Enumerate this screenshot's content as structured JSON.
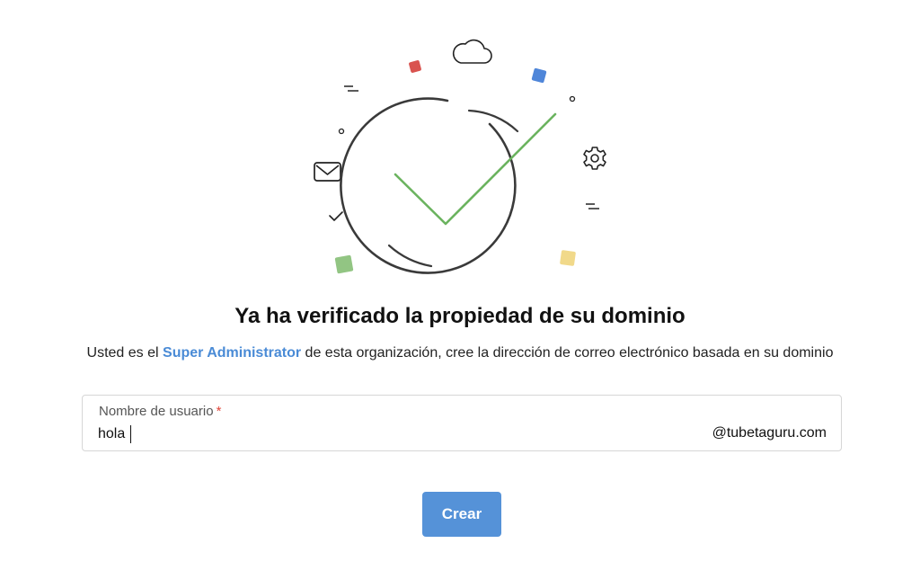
{
  "heading": "Ya ha verificado la propiedad de su dominio",
  "subtitle": {
    "before": "Usted es el ",
    "highlight": "Super Administrator",
    "after": " de esta organización, cree la dirección de correo electrónico basada en su dominio"
  },
  "username_field": {
    "label": "Nombre de usuario",
    "required_mark": "*",
    "value": "hola",
    "domain_suffix": "@tubetaguru.com"
  },
  "create_button": {
    "label": "Crear"
  },
  "colors": {
    "accent": "#5592d8",
    "highlight_text": "#4a8bd6",
    "check_green": "#6bb35f",
    "required": "#e0463a"
  },
  "illustration_icons": [
    "cloud-icon",
    "envelope-icon",
    "gear-icon",
    "checkmark-icon"
  ]
}
